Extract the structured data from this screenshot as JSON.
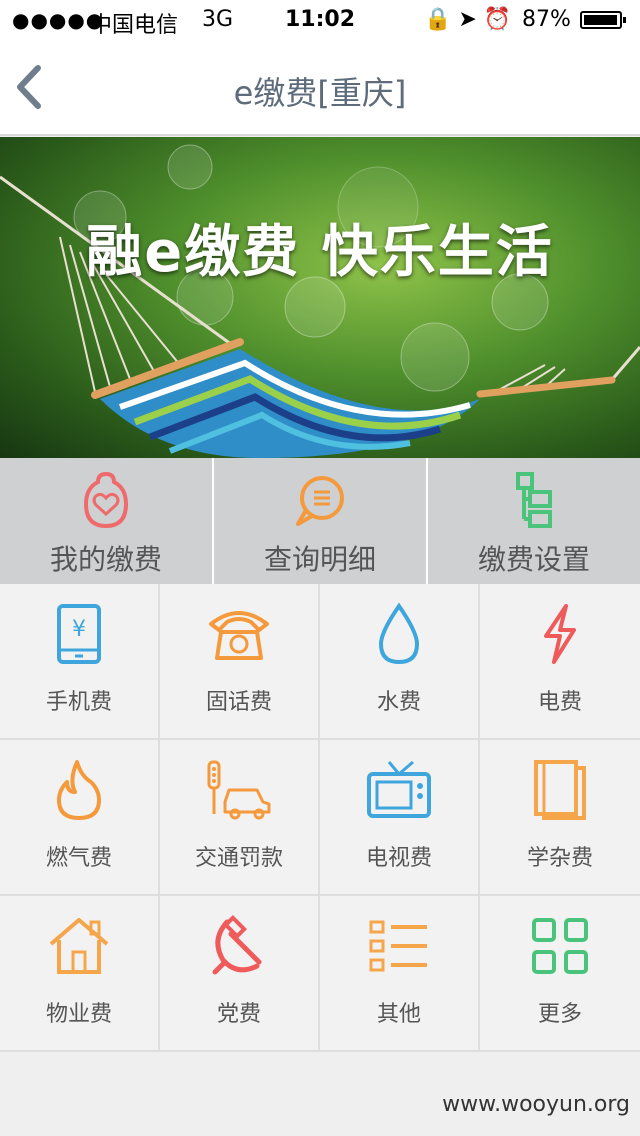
{
  "status_bar": {
    "signal": "●●●●●",
    "carrier": "中国电信",
    "network": "3G",
    "time": "11:02",
    "icons": "🔒 ➤ ⏰",
    "battery_pct": "87%"
  },
  "nav": {
    "title": "e缴费[重庆]",
    "back_icon": "chevron-left-icon"
  },
  "banner": {
    "slogan": "融e缴费  快乐生活"
  },
  "quick_actions": [
    {
      "label": "我的缴费",
      "icon": "piggy-bank-icon",
      "color": "#ef6a6a"
    },
    {
      "label": "查询明细",
      "icon": "chat-list-icon",
      "color": "#f59a3c"
    },
    {
      "label": "缴费设置",
      "icon": "settings-blocks-icon",
      "color": "#49c47a"
    }
  ],
  "services": [
    {
      "label": "手机费",
      "icon": "mobile-yen-icon",
      "color": "#3ea6dc"
    },
    {
      "label": "固话费",
      "icon": "telephone-icon",
      "color": "#f59a3c"
    },
    {
      "label": "水费",
      "icon": "water-drop-icon",
      "color": "#3ea6dc"
    },
    {
      "label": "电费",
      "icon": "lightning-icon",
      "color": "#ef5a5a"
    },
    {
      "label": "燃气费",
      "icon": "flame-icon",
      "color": "#f59a3c"
    },
    {
      "label": "交通罚款",
      "icon": "traffic-car-icon",
      "color": "#f59a3c"
    },
    {
      "label": "电视费",
      "icon": "tv-icon",
      "color": "#3ea6dc"
    },
    {
      "label": "学杂费",
      "icon": "books-icon",
      "color": "#f5a54a"
    },
    {
      "label": "物业费",
      "icon": "house-icon",
      "color": "#f5a54a"
    },
    {
      "label": "党费",
      "icon": "hammer-sickle-icon",
      "color": "#ef5a5a"
    },
    {
      "label": "其他",
      "icon": "list-icon",
      "color": "#f5a54a"
    },
    {
      "label": "更多",
      "icon": "grid-more-icon",
      "color": "#49c47a"
    }
  ],
  "watermark": "www.wooyun.org"
}
